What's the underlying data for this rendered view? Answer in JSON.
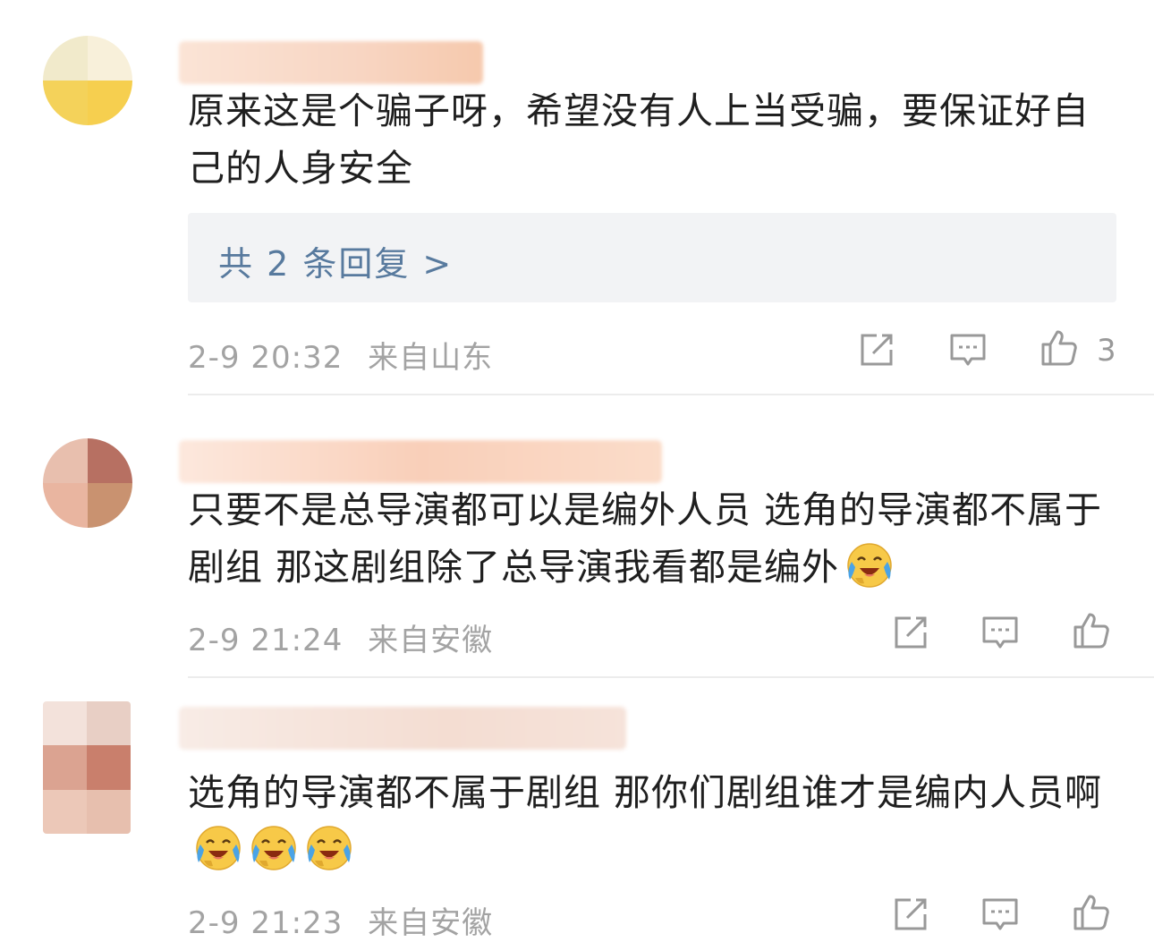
{
  "comments": [
    {
      "text": "原来这是个骗子呀，希望没有人上当受骗，要保证好自己的人身安全",
      "replies_label": "共 2 条回复 >",
      "date": "2-9 20:32",
      "location": "来自山东",
      "likes": "3"
    },
    {
      "text": "只要不是总导演都可以是编外人员 选角的导演都不属于剧组 那这剧组除了总导演我看都是编外",
      "date": "2-9 21:24",
      "location": "来自安徽"
    },
    {
      "text": "选角的导演都不属于剧组 那你们剧组谁才是编内人员啊",
      "date": "2-9 21:23",
      "location": "来自安徽"
    }
  ],
  "icons": {
    "share": "share-icon",
    "comment": "comment-icon",
    "like": "thumbs-up-icon",
    "emoji": "crying-laughing-emoji"
  },
  "colors": {
    "reply_link": "#587a9e",
    "meta_text": "#a3a3a3",
    "reply_bg": "#f2f3f5"
  }
}
